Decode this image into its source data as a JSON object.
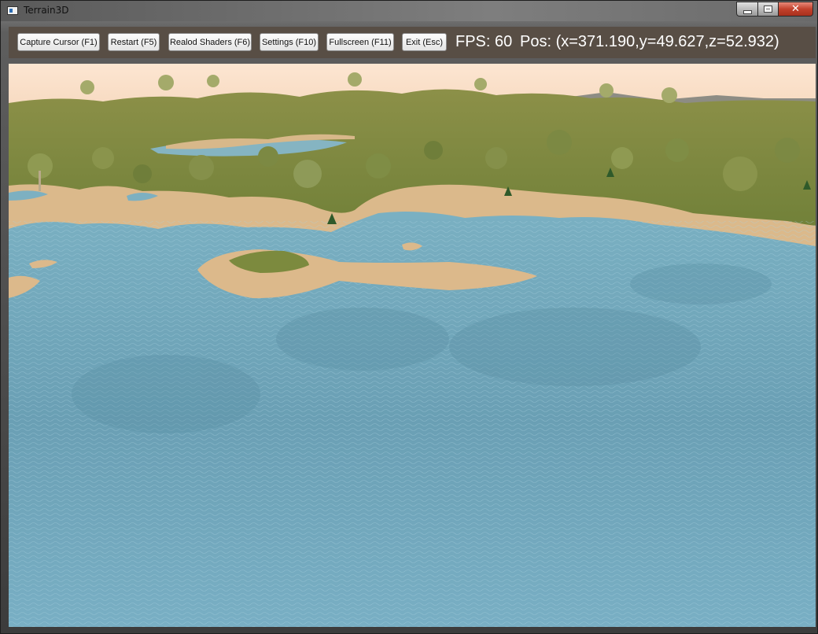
{
  "window": {
    "title": "Terrain3D",
    "close_symbol": "✕"
  },
  "toolbar": {
    "buttons": [
      "Capture Cursor (F1)",
      "Restart (F5)",
      "Realod Shaders (F6)",
      "Settings (F10)",
      "Fullscreen (F11)",
      "Exit (Esc)"
    ],
    "fps_text": "FPS: 60",
    "pos_text": "Pos: (x=371.190,y=49.627,z=52.932)"
  },
  "scene": {
    "colors": {
      "sky": "#fde3cd",
      "grass": "#7f8a3e",
      "sand": "#dcb98c",
      "water": "#6fa3b7",
      "rock": "#8f8f87",
      "toolbar": "#584e45"
    }
  }
}
